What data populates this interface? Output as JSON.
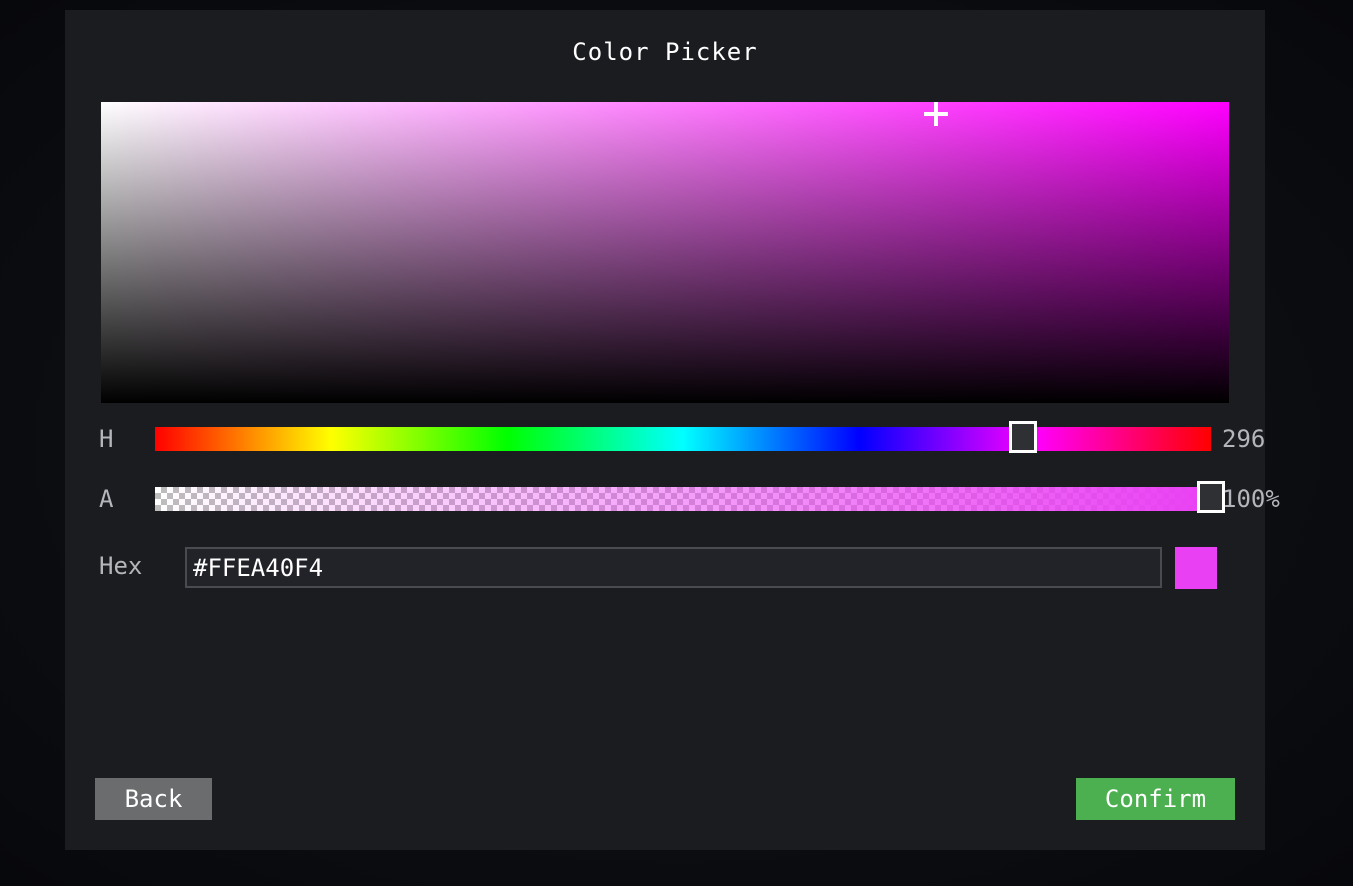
{
  "dialog": {
    "title": "Color Picker"
  },
  "saturation_value": {
    "saturation": 0.74,
    "value": 0.96
  },
  "hue": {
    "label": "H",
    "value": 296,
    "max": 360,
    "display": "296"
  },
  "alpha": {
    "label": "A",
    "value": 100,
    "display": "100%"
  },
  "hex": {
    "label": "Hex",
    "value": "#FFEA40F4"
  },
  "preview": {
    "color": "#ea40f4"
  },
  "buttons": {
    "back_label": "Back",
    "confirm_label": "Confirm"
  },
  "colors": {
    "panel_background": "#1b1c20",
    "confirm_button": "#4caf50",
    "back_button": "#6b6c6e"
  }
}
